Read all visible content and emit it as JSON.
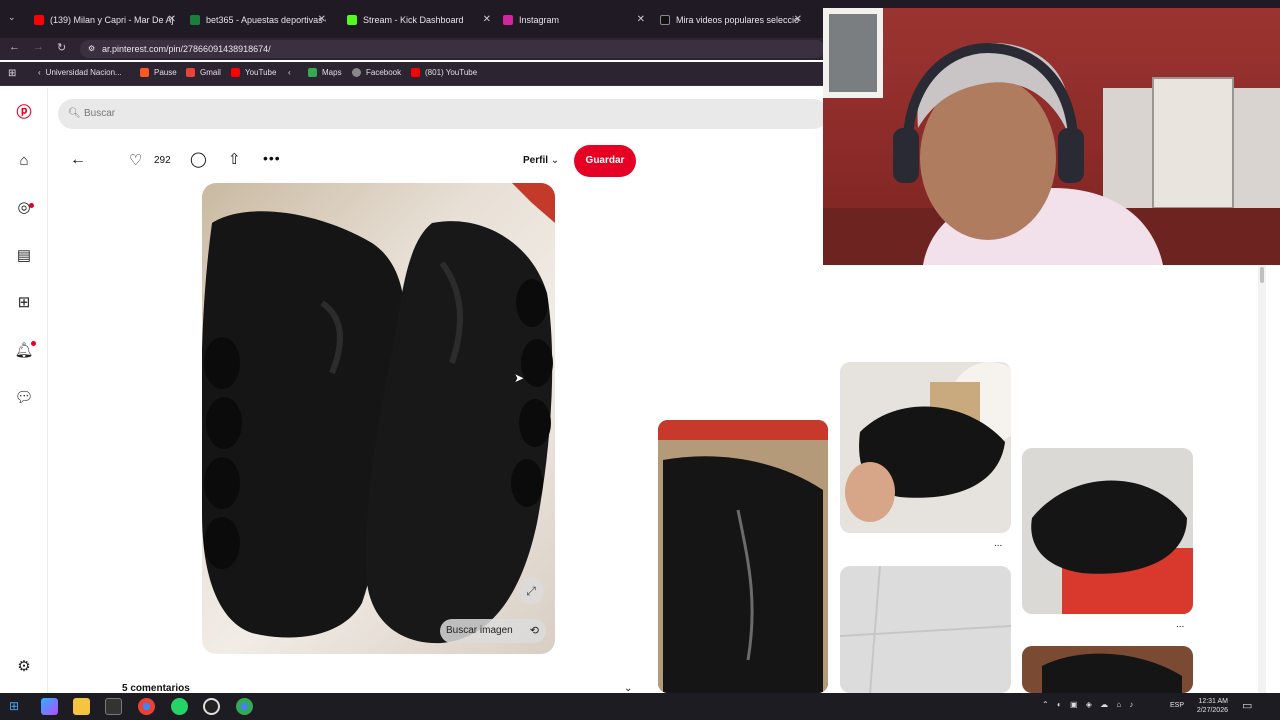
{
  "browser": {
    "tabs": [
      {
        "title": "(139) Milan y Capri - Mar De Aj",
        "color": "#ff0000"
      },
      {
        "title": "bet365 - Apuestas deportivas e",
        "color": "#1a7f3c"
      },
      {
        "title": "Stream - Kick Dashboard",
        "color": "#53fc18"
      },
      {
        "title": "Instagram",
        "color": "#d6249f"
      },
      {
        "title": "Mira videos populares seleccio",
        "color": "#111111"
      }
    ],
    "url": "ar.pinterest.com/pin/27866091438918674/",
    "bookmarks": [
      {
        "label": "Universidad Nacion...",
        "color": "#1e88e5"
      },
      {
        "label": "Pause",
        "color": "#ff5722"
      },
      {
        "label": "Gmail",
        "color": "#ea4335"
      },
      {
        "label": "YouTube",
        "color": "#ff0000"
      },
      {
        "label": "Maps",
        "color": "#34a853"
      },
      {
        "label": "Facebook",
        "color": "#888888"
      },
      {
        "label": "(801) YouTube",
        "color": "#ff0000"
      }
    ]
  },
  "search": {
    "placeholder": "Buscar"
  },
  "pin": {
    "likes": "292",
    "perfil_label": "Perfil",
    "save_label": "Guardar",
    "search_image_label": "Buscar imagen",
    "comments_label": "5 comentarios"
  },
  "related": {
    "more_1": "...",
    "more_2": "..."
  },
  "taskbar": {
    "lang": "ESP",
    "time": "12:31 AM",
    "date": "2/27/2026"
  },
  "colors": {
    "accent": "#e60023",
    "tabbar": "#1f1a24",
    "toolbar": "#2c2430"
  }
}
